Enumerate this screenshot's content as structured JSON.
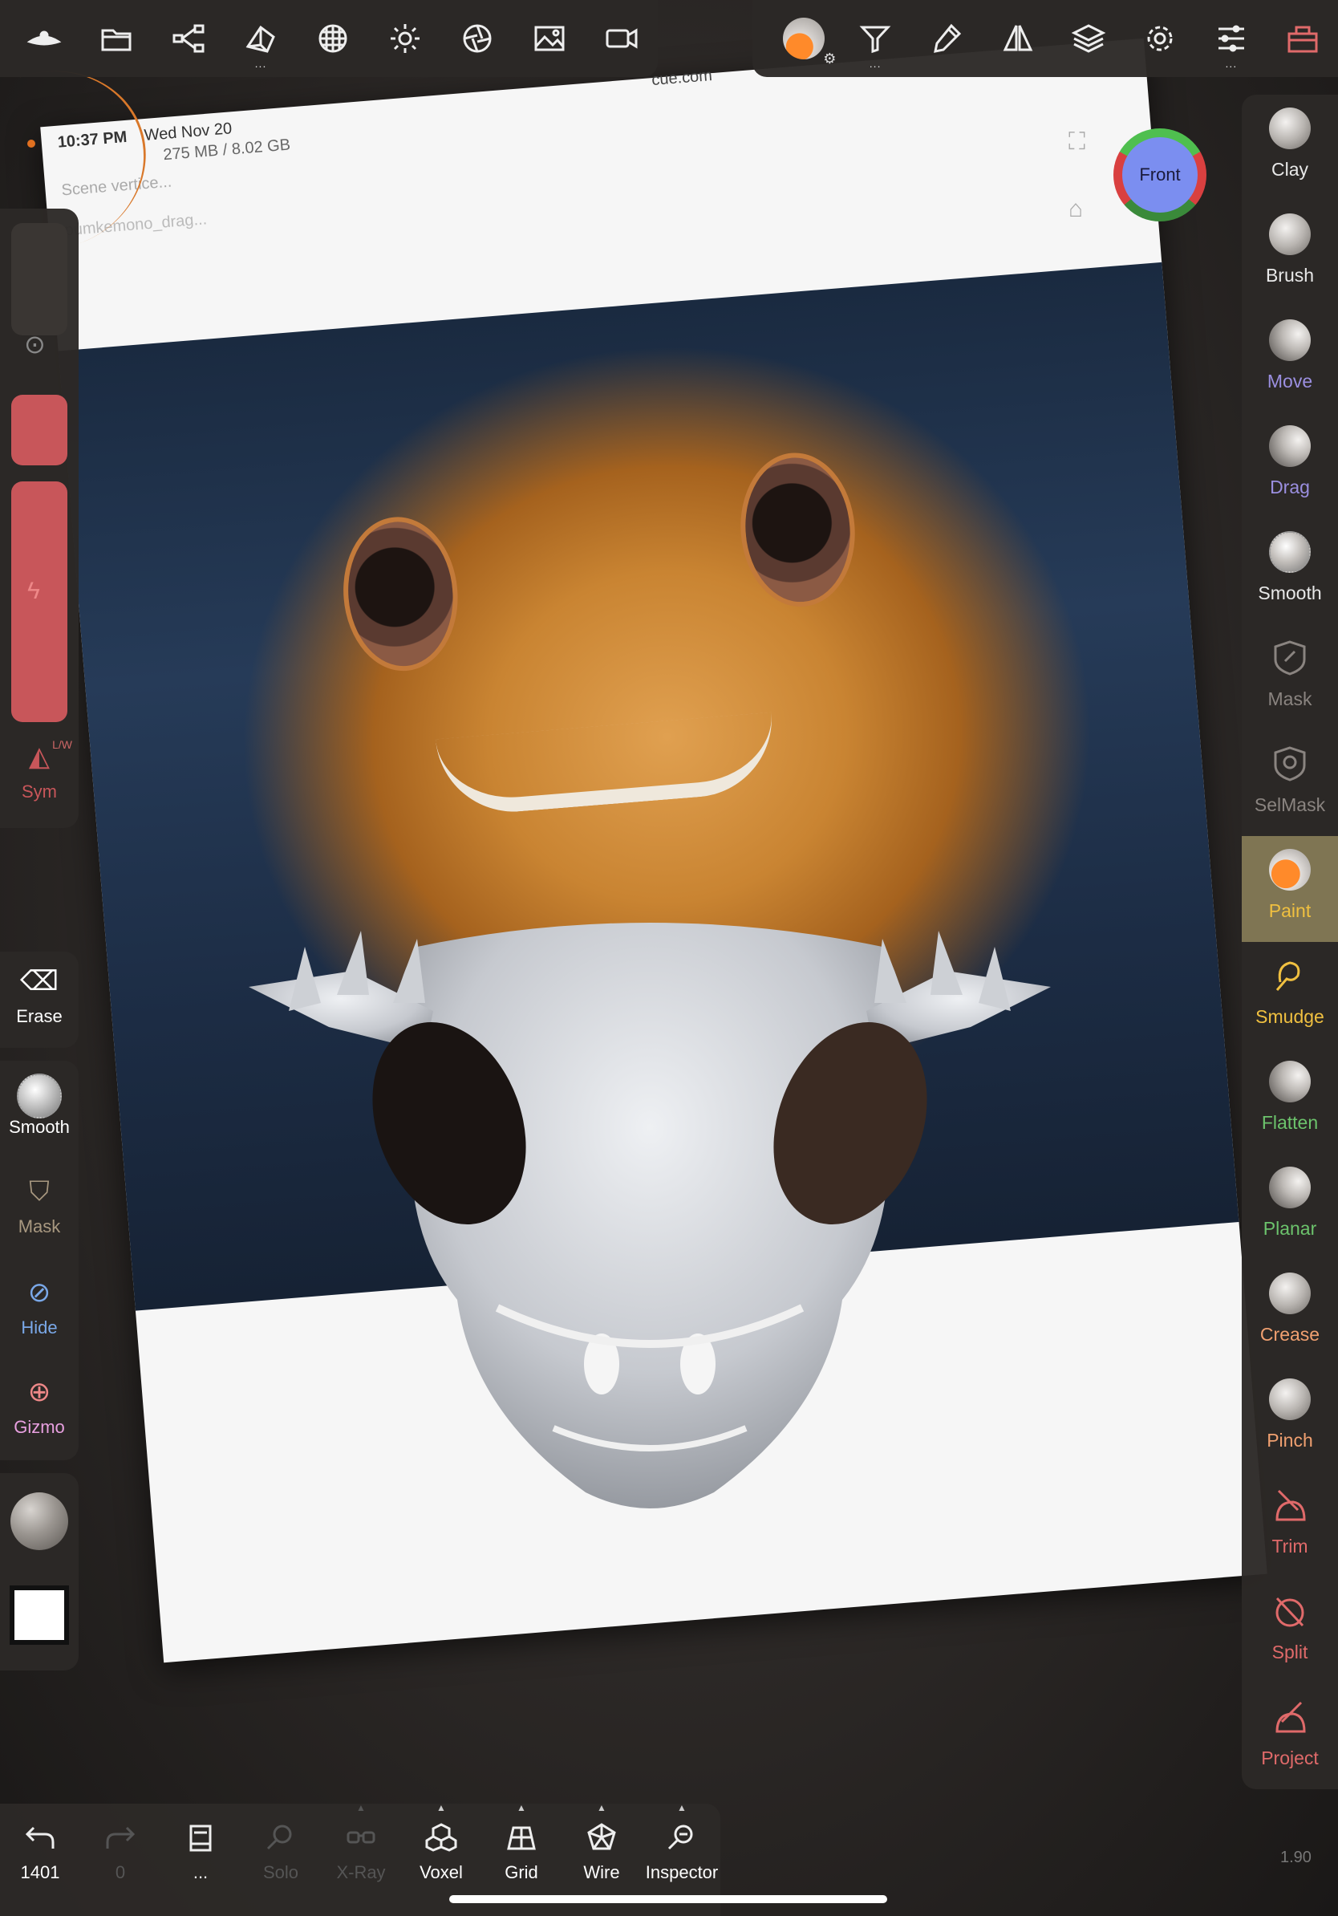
{
  "reference": {
    "time": "10:37 PM",
    "date": "Wed Nov 20",
    "url": "cue.com",
    "memory": "275 MB / 8.02 GB",
    "scene": "Scene vertice...",
    "file": "pumkemono_drag..."
  },
  "top_left_toolbar": [
    {
      "name": "logo-icon"
    },
    {
      "name": "folder-icon"
    },
    {
      "name": "share-icon"
    },
    {
      "name": "scene-icon"
    },
    {
      "name": "topology-icon"
    },
    {
      "name": "light-icon"
    },
    {
      "name": "camera-lens-icon"
    },
    {
      "name": "image-icon"
    },
    {
      "name": "video-icon"
    }
  ],
  "top_right_toolbar": [
    {
      "name": "paint-material-icon"
    },
    {
      "name": "filter-icon"
    },
    {
      "name": "eyedropper-icon"
    },
    {
      "name": "symmetry-icon"
    },
    {
      "name": "layers-icon"
    },
    {
      "name": "settings-icon"
    },
    {
      "name": "sliders-icon"
    },
    {
      "name": "toolbox-icon"
    }
  ],
  "view_cube": {
    "face_label": "Front"
  },
  "left_sidebar": {
    "sym_label": "Sym",
    "sym_sub": "L/W",
    "buttons": [
      {
        "label": "Erase"
      },
      {
        "label": "Smooth"
      },
      {
        "label": "Mask"
      },
      {
        "label": "Hide"
      },
      {
        "label": "Gizmo"
      }
    ]
  },
  "tools": [
    {
      "label": "Clay",
      "color": "#e8e8e8"
    },
    {
      "label": "Brush",
      "color": "#e8e8e8"
    },
    {
      "label": "Move",
      "color": "#9b8fe0"
    },
    {
      "label": "Drag",
      "color": "#9b8fe0"
    },
    {
      "label": "Smooth",
      "color": "#e8e8e8"
    },
    {
      "label": "Mask",
      "color": "#8a8480"
    },
    {
      "label": "SelMask",
      "color": "#8a8480"
    },
    {
      "label": "Paint",
      "color": "#f0c040"
    },
    {
      "label": "Smudge",
      "color": "#f0c040"
    },
    {
      "label": "Flatten",
      "color": "#6cc36c"
    },
    {
      "label": "Planar",
      "color": "#6cc36c"
    },
    {
      "label": "Crease",
      "color": "#f0a070"
    },
    {
      "label": "Pinch",
      "color": "#f0a070"
    },
    {
      "label": "Trim",
      "color": "#e06a6a"
    },
    {
      "label": "Split",
      "color": "#e06a6a"
    },
    {
      "label": "Project",
      "color": "#e06a6a"
    }
  ],
  "bottom_bar": [
    {
      "label": "1401",
      "name": "undo",
      "enabled": true
    },
    {
      "label": "0",
      "name": "redo",
      "enabled": false
    },
    {
      "label": "...",
      "name": "notes",
      "enabled": true
    },
    {
      "label": "Solo",
      "name": "solo",
      "enabled": false
    },
    {
      "label": "X-Ray",
      "name": "xray",
      "enabled": false
    },
    {
      "label": "Voxel",
      "name": "voxel",
      "enabled": true
    },
    {
      "label": "Grid",
      "name": "grid",
      "enabled": true
    },
    {
      "label": "Wire",
      "name": "wire",
      "enabled": true
    },
    {
      "label": "Inspector",
      "name": "inspector",
      "enabled": true
    }
  ],
  "version": "1.90",
  "colors": {
    "accent": "#e06a6a",
    "active_tool_bg": "#7f7553",
    "panel": "#2c2927"
  }
}
